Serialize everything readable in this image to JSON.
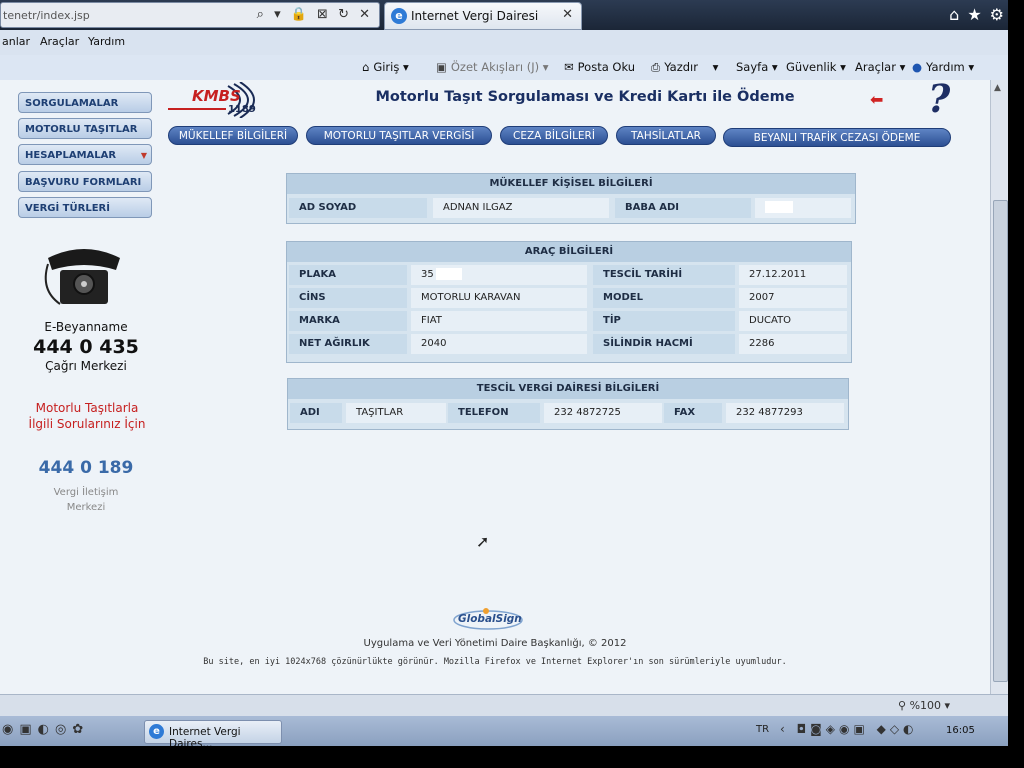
{
  "browser": {
    "address_text": "tenetr/index.jsp",
    "address_icons": "⌕ ▾ 🔒 ⊠ ↻ ✕",
    "tab_title": "Internet Vergi Dairesi",
    "menu": [
      "anlar",
      "Araçlar",
      "Yardım"
    ],
    "commands": {
      "giris": "Giriş",
      "ozet": "Özet Akışları (J)",
      "posta": "Posta Oku",
      "yazdir": "Yazdır",
      "sayfa": "Sayfa",
      "guvenlik": "Güvenlik",
      "araclar": "Araçlar",
      "yardim": "Yardım"
    },
    "zoom": "%100"
  },
  "sidebar": {
    "items": [
      {
        "label": "SORGULAMALAR"
      },
      {
        "label": "MOTORLU TAŞITLAR"
      },
      {
        "label": "HESAPLAMALAR"
      },
      {
        "label": "BAŞVURU FORMLARI"
      },
      {
        "label": "VERGİ TÜRLERİ"
      }
    ],
    "ebeyanname": "E-Beyanname",
    "ebey_phone": "444 0 435",
    "cagri": "Çağrı Merkezi",
    "motorlu_text": "Motorlu Taşıtlarla İlgili Sorularınız İçin",
    "motorlu_phone": "444 0 189",
    "vergi_iletisim": "Vergi İletişim Merkezi"
  },
  "header": {
    "logo_text": "KMBS",
    "logo_num": "1189",
    "title": "Motorlu Taşıt Sorgulaması ve Kredi Kartı ile Ödeme"
  },
  "tabs": [
    {
      "label": "MÜKELLEF BİLGİLERİ"
    },
    {
      "label": "MOTORLU TAŞITLAR VERGİSİ"
    },
    {
      "label": "CEZA BİLGİLERİ"
    },
    {
      "label": "TAHSİLATLAR"
    },
    {
      "label": "BEYANLI TRAFİK CEZASI ÖDEME"
    }
  ],
  "mukellef": {
    "heading": "MÜKELLEF KİŞİSEL BİLGİLERİ",
    "ad_soyad_label": "AD SOYAD",
    "ad_soyad_value": "ADNAN ILGAZ",
    "baba_adi_label": "BABA ADI"
  },
  "arac": {
    "heading": "ARAÇ BİLGİLERİ",
    "rows": [
      {
        "l1": "PLAKA",
        "v1": "35",
        "l2": "TESCİL TARİHİ",
        "v2": "27.12.2011"
      },
      {
        "l1": "CİNS",
        "v1": "MOTORLU KARAVAN",
        "l2": "MODEL",
        "v2": "2007"
      },
      {
        "l1": "MARKA",
        "v1": "FIAT",
        "l2": "TİP",
        "v2": "DUCATO"
      },
      {
        "l1": "NET AĞIRLIK",
        "v1": "2040",
        "l2": "SİLİNDİR HACMİ",
        "v2": "2286"
      }
    ]
  },
  "tescil": {
    "heading": "TESCİL VERGİ DAİRESİ BİLGİLERİ",
    "adi_label": "ADI",
    "adi_value": "TAŞITLAR",
    "telefon_label": "TELEFON",
    "telefon_value": "232 4872725",
    "fax_label": "FAX",
    "fax_value": "232 4877293"
  },
  "footer": {
    "globalsign": "GlobalSign",
    "copyright": "Uygulama ve Veri Yönetimi Daire Başkanlığı, © 2012",
    "note": "Bu site, en iyi 1024x768 çözünürlükte görünür. Mozilla Firefox ve Internet Explorer'ın son sürümleriyle uyumludur."
  },
  "taskbar": {
    "task_label": "Internet Vergi Daires...",
    "lang": "TR",
    "time": "16:05"
  }
}
